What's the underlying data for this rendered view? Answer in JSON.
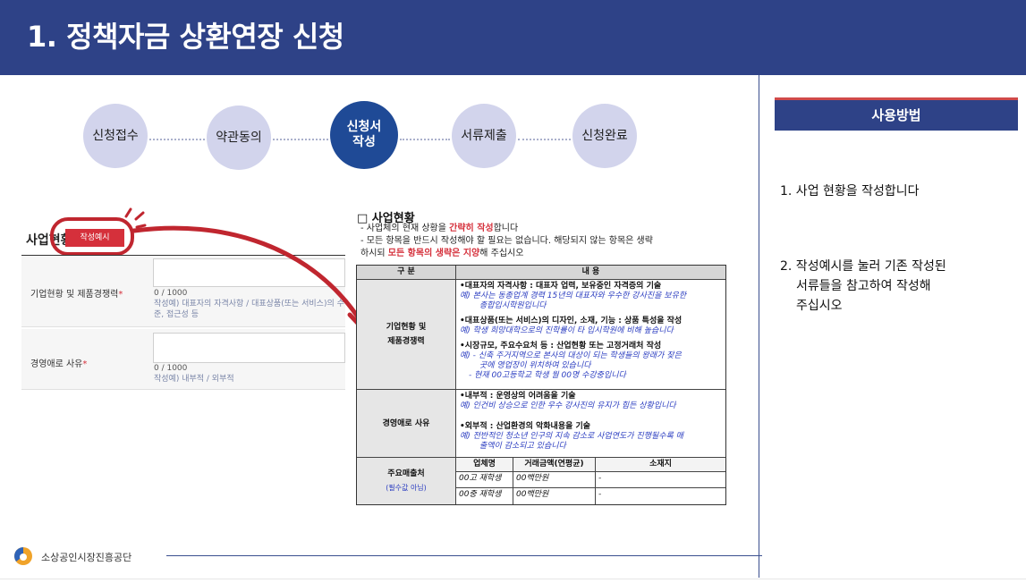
{
  "page": {
    "title": "1. 정책자금 상환연장 신청"
  },
  "steps": [
    {
      "label": "신청접수"
    },
    {
      "label": "약관동의"
    },
    {
      "label": "신청서\n작성"
    },
    {
      "label": "서류제출"
    },
    {
      "label": "신청완료"
    }
  ],
  "form": {
    "title": "사업현황",
    "sample_button": "작성예시",
    "rows": [
      {
        "label": "기업현황 및 제품경쟁력",
        "required_mark": "*",
        "count": "0 / 1000",
        "hint": "작성예) 대표자의 자격사항 / 대표상품(또는 서비스)의 수준, 접근성 등"
      },
      {
        "label": "경영애로 사유",
        "required_mark": "*",
        "count": "0 / 1000",
        "hint": "작성예) 내부적 / 외부적"
      }
    ]
  },
  "doc": {
    "title": "□ 사업현황",
    "notes": [
      {
        "pre": "- 사업체의 현재 상황을 ",
        "em": "간략히 작성",
        "post": "합니다"
      },
      {
        "pre": "- 모든 항목을 반드시 작성해야 할 필요는 없습니다. 해당되지 않는 항목은 생략",
        "em": "",
        "post": ""
      },
      {
        "pre": "  하시되 ",
        "em": "모든 항목의 생략은 지양",
        "post": "해 주십시오"
      }
    ],
    "table": {
      "headers": [
        "구 분",
        "내 용"
      ],
      "rows": [
        {
          "label": "기업현황 및\n제품경쟁력",
          "items": [
            {
              "head": "•대표자의 자격사항 : 대표자 업력, 보유중인 자격증의 기술",
              "ex": [
                "예) 본사는 동종업계 경력 15년의 대표자와 우수한 강사진을 보유한",
                "종합입시학원입니다"
              ]
            },
            {
              "head": "•대표상품(또는 서비스)의 디자인, 소재, 기능 : 상품 특성을 작성",
              "ex": [
                "예) 학생 희망대학으로의 진학률이 타 입시학원에 비해 높습니다"
              ]
            },
            {
              "head": "•시장규모, 주요수요처 등 : 산업현황 또는 고정거래처 작성",
              "ex": [
                "예) - 신축 주거지역으로 본사의 대상이 되는 학생들의 왕래가 잦은",
                "곳에 영업장이 위치하여 있습니다",
                "- 현재 00고등학교 학생 월 00명 수강중입니다"
              ]
            }
          ]
        },
        {
          "label": "경영애로 사유",
          "items": [
            {
              "head": "•내부적 : 운영상의 어려움을 기술",
              "ex": [
                "예) 인건비 상승으로 인한 우수 강사진의 유지가 힘든 상황입니다"
              ]
            },
            {
              "head": "•외부적 : 산업환경의 악화내용을 기술",
              "ex": [
                "예) 전반적인 청소년 인구의 지속 감소로 사업연도가 진행될수록 매",
                "출액이 감소되고 있습니다"
              ]
            }
          ]
        }
      ],
      "sales": {
        "label": "주요매출처",
        "sublabel": "(필수값 아님)",
        "headers": [
          "업체명",
          "거래금액(연평균)",
          "소재지"
        ],
        "rows": [
          [
            "00고 재학생",
            "00백만원",
            "-"
          ],
          [
            "00중 재학생",
            "00백만원",
            "-"
          ]
        ]
      }
    }
  },
  "panel": {
    "title": "사용방법",
    "instructions": [
      "1. 사업 현황을 작성합니다",
      "2. 작성예시를 눌러 기존 작성된",
      "서류들을 참고하여 작성해",
      "주십시오"
    ]
  },
  "footer": {
    "org": "소상공인시장진흥공단"
  },
  "colors": {
    "header": "#2e4287",
    "step_inactive": "#d2d4ec",
    "step_active": "#1f4a96",
    "highlight_red": "#c0262f",
    "example_blue": "#2a3cc0"
  }
}
